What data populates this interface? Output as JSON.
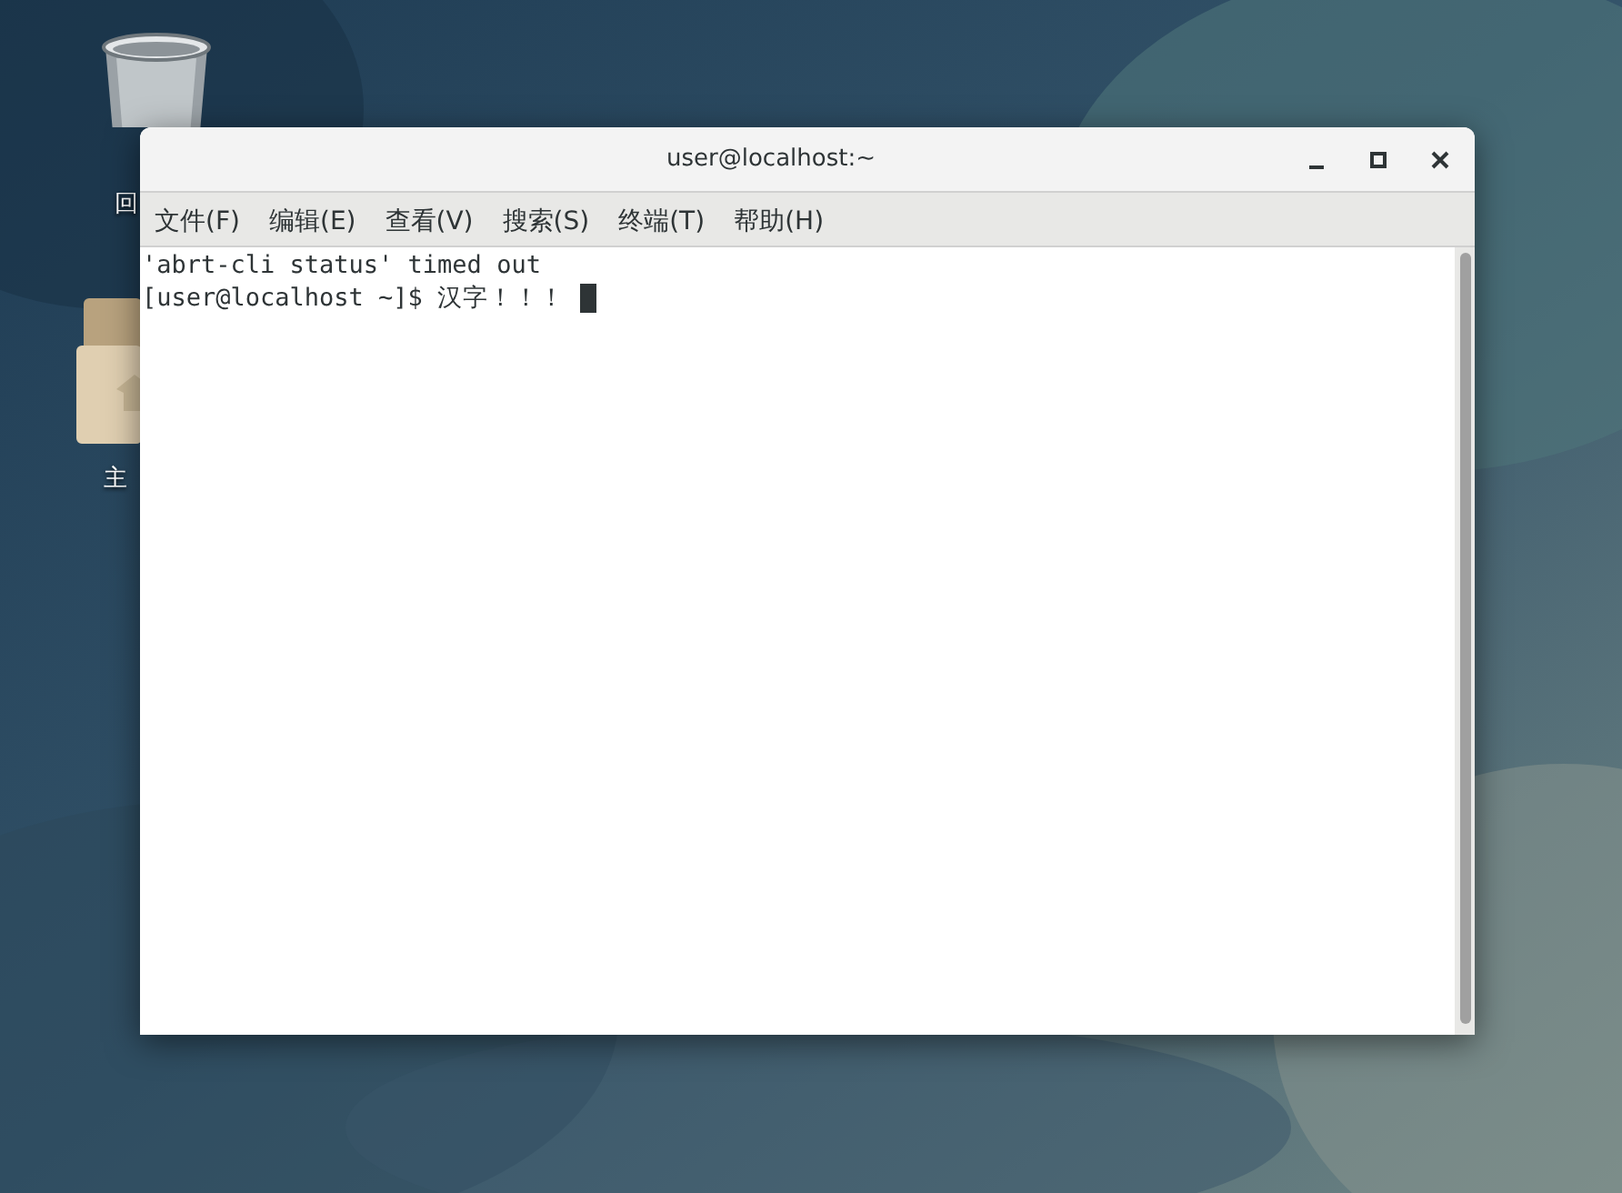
{
  "desktop": {
    "icons": [
      {
        "kind": "trash",
        "label": "回"
      },
      {
        "kind": "folder",
        "label": "主"
      }
    ]
  },
  "window": {
    "title": "user@localhost:~",
    "menu": [
      "文件(F)",
      "编辑(E)",
      "查看(V)",
      "搜索(S)",
      "终端(T)",
      "帮助(H)"
    ],
    "terminal": {
      "lines": [
        "'abrt-cli status' timed out",
        "[user@localhost ~]$ 汉字！！！"
      ]
    }
  }
}
